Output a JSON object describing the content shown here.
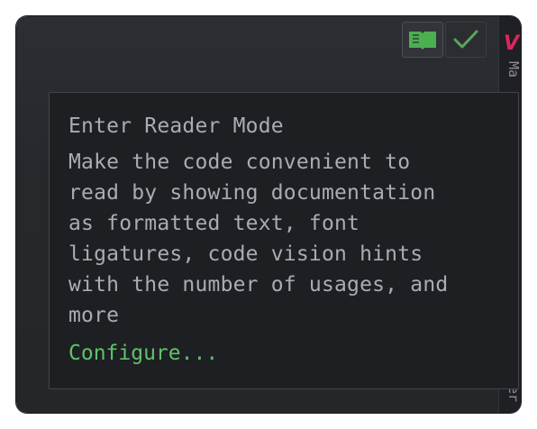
{
  "toolbar": {
    "buttons": [
      {
        "icon": "book-icon",
        "color": "#4caf50"
      },
      {
        "icon": "checkmark-icon",
        "color": "#5aa55a"
      }
    ]
  },
  "editor_edge": {
    "accent_glyph": "V",
    "accent_color": "#e0245e",
    "text_top": "Ma",
    "text_bottom": "er"
  },
  "popup": {
    "title": "Enter Reader Mode",
    "body_lines": [
      "Make the code convenient to",
      "read by showing documentation",
      "as formatted text, font",
      "ligatures, code vision hints",
      "with the number of usages, and",
      "more"
    ],
    "link": "Configure...",
    "link_color": "#5ec26b"
  }
}
